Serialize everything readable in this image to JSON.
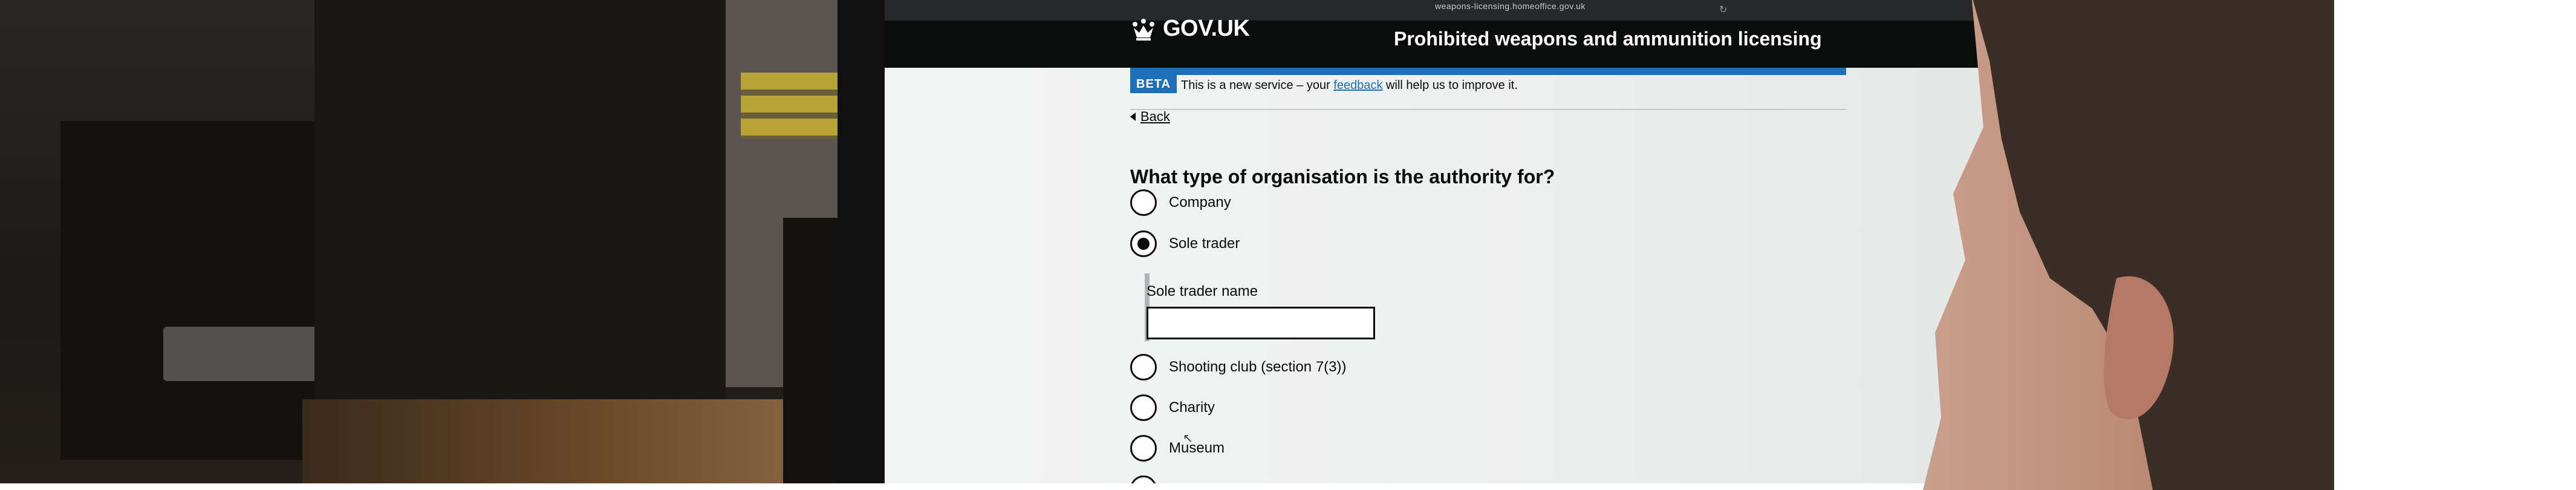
{
  "browser": {
    "address": "weapons-licensing.homeoffice.gov.uk",
    "reload_icon": "reload-icon",
    "share_icon": "share-icon"
  },
  "header": {
    "logo_text": "GOV.UK",
    "logo_icon": "crown-icon",
    "service_name": "Prohibited weapons and ammunition licensing"
  },
  "phase_banner": {
    "tag": "BETA",
    "text_before": "This is a new service – your ",
    "link_text": "feedback",
    "text_after": " will help us to improve it."
  },
  "back_link": {
    "label": "Back"
  },
  "question": "What type of organisation is the authority for?",
  "options": [
    {
      "label": "Company",
      "checked": false
    },
    {
      "label": "Sole trader",
      "checked": true
    },
    {
      "label": "Shooting club (section 7(3))",
      "checked": false
    },
    {
      "label": "Charity",
      "checked": false
    },
    {
      "label": "Museum",
      "checked": false
    }
  ],
  "conditional": {
    "label": "Sole trader name",
    "value": ""
  },
  "colors": {
    "header": "#0b0c0c",
    "accent_blue": "#1d70b8",
    "text": "#0b0c0c",
    "page_bg": "#eeefef"
  }
}
